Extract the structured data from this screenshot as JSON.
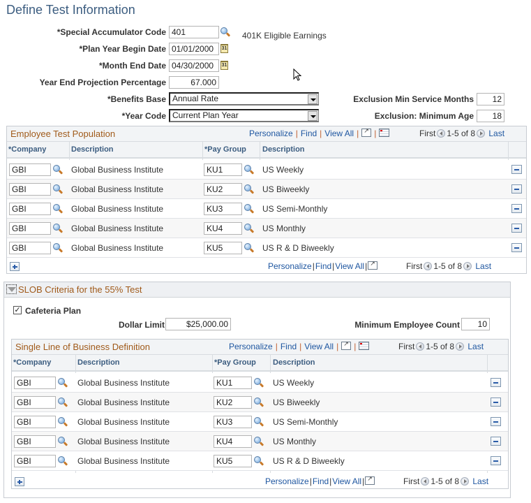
{
  "page": {
    "title": "Define Test Information"
  },
  "form": {
    "special_accumulator_code": {
      "label": "*Special Accumulator Code",
      "value": "401",
      "description": "401K Eligible Earnings"
    },
    "plan_year_begin_date": {
      "label": "*Plan Year Begin Date",
      "value": "01/01/2000"
    },
    "month_end_date": {
      "label": "*Month End Date",
      "value": "04/30/2000"
    },
    "year_end_projection_percentage": {
      "label": "Year End Projection Percentage",
      "value": "67.000"
    },
    "benefits_base": {
      "label": "*Benefits Base",
      "value": "Annual Rate"
    },
    "year_code": {
      "label": "*Year Code",
      "value": "Current Plan Year"
    },
    "exclusion_min_service_months": {
      "label": "Exclusion Min Service Months",
      "value": "12"
    },
    "exclusion_minimum_age": {
      "label": "Exclusion: Minimum Age",
      "value": "18"
    },
    "calendar_icon_text": "31"
  },
  "employee_test_population": {
    "title": "Employee Test Population",
    "nav": {
      "personalize": "Personalize",
      "find": "Find",
      "view_all": "View All",
      "first": "First",
      "range": "1-5 of 8",
      "last": "Last"
    },
    "columns": [
      "*Company",
      "Description",
      "*Pay Group",
      "Description"
    ],
    "rows": [
      {
        "company": "GBI",
        "company_desc": "Global Business Institute",
        "pay_group": "KU1",
        "pay_group_desc": "US Weekly"
      },
      {
        "company": "GBI",
        "company_desc": "Global Business Institute",
        "pay_group": "KU2",
        "pay_group_desc": "US Biweekly"
      },
      {
        "company": "GBI",
        "company_desc": "Global Business Institute",
        "pay_group": "KU3",
        "pay_group_desc": "US Semi-Monthly"
      },
      {
        "company": "GBI",
        "company_desc": "Global Business Institute",
        "pay_group": "KU4",
        "pay_group_desc": "US Monthly"
      },
      {
        "company": "GBI",
        "company_desc": "Global Business Institute",
        "pay_group": "KU5",
        "pay_group_desc": "US R & D Biweekly"
      }
    ]
  },
  "slob": {
    "title": "SLOB Criteria for the 55% Test",
    "cafeteria_plan": {
      "label": "Cafeteria Plan",
      "checked": true,
      "check_glyph": "✓"
    },
    "dollar_limit": {
      "label": "Dollar Limit",
      "value": "$25,000.00"
    },
    "minimum_employee_count": {
      "label": "Minimum Employee Count",
      "value": "10"
    },
    "grid": {
      "title": "Single Line of Business Definition",
      "nav": {
        "personalize": "Personalize",
        "find": "Find",
        "view_all": "View All",
        "first": "First",
        "range": "1-5 of 8",
        "last": "Last"
      },
      "columns": [
        "*Company",
        "Description",
        "*Pay Group",
        "Description"
      ],
      "rows": [
        {
          "company": "GBI",
          "company_desc": "Global Business Institute",
          "pay_group": "KU1",
          "pay_group_desc": "US Weekly"
        },
        {
          "company": "GBI",
          "company_desc": "Global Business Institute",
          "pay_group": "KU2",
          "pay_group_desc": "US Biweekly"
        },
        {
          "company": "GBI",
          "company_desc": "Global Business Institute",
          "pay_group": "KU3",
          "pay_group_desc": "US Semi-Monthly"
        },
        {
          "company": "GBI",
          "company_desc": "Global Business Institute",
          "pay_group": "KU4",
          "pay_group_desc": "US Monthly"
        },
        {
          "company": "GBI",
          "company_desc": "Global Business Institute",
          "pay_group": "KU5",
          "pay_group_desc": "US R & D Biweekly"
        }
      ]
    }
  },
  "colors": {
    "title": "#3c5d80",
    "section_title": "#a05a1a",
    "link": "#1e56a0"
  }
}
